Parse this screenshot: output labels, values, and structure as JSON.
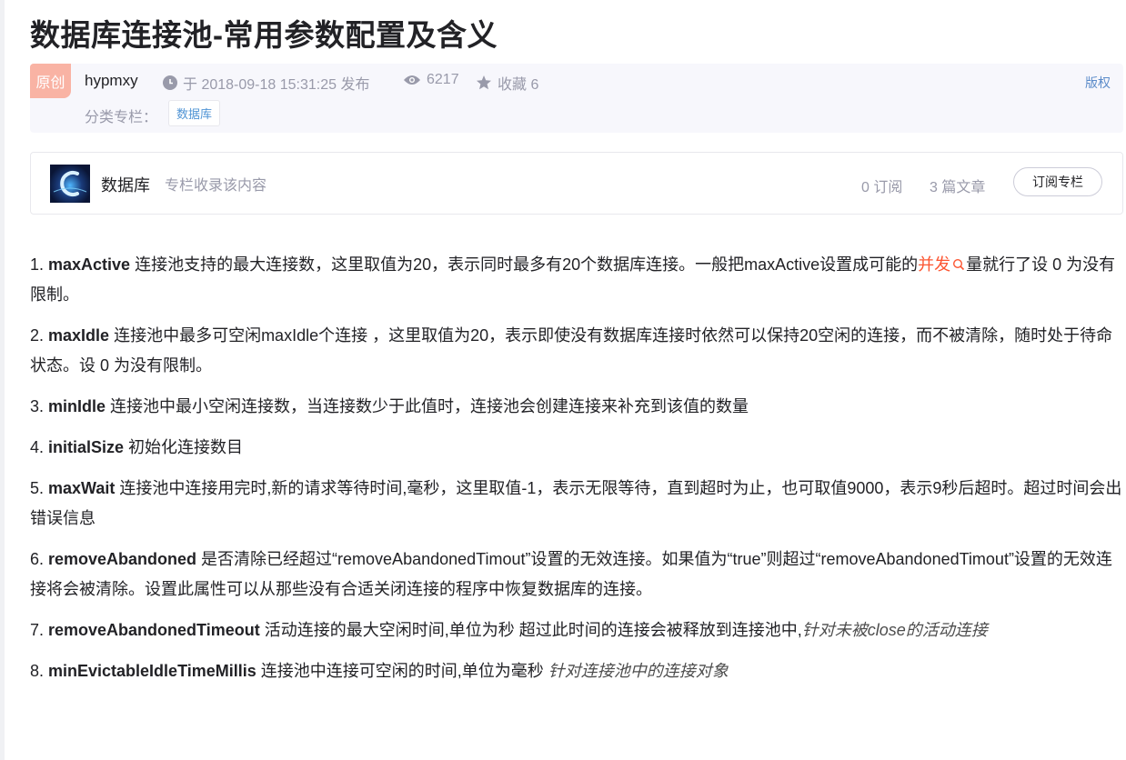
{
  "article": {
    "title": "数据库连接池-常用参数配置及含义",
    "badge": "原创",
    "author": "hypmxy",
    "published": "于 2018-09-18 15:31:25 发布",
    "views": "6217",
    "favorites": "收藏 6",
    "copyright": "版权",
    "category_label": "分类专栏：",
    "category_tag": "数据库"
  },
  "column": {
    "name": "数据库",
    "desc": "专栏收录该内容",
    "subscriptions": "0 订阅",
    "articles": "3 篇文章",
    "subscribe_label": "订阅专栏"
  },
  "params": [
    {
      "n": "1. ",
      "key": "maxActive",
      "desc": " 连接池支持的最大连接数，这里取值为20，表示同时最多有20个数据库连接。一般把maxActive设置成可能的",
      "link": "并发",
      "tail": "量就行了设 0 为没有限制。"
    },
    {
      "n": "2. ",
      "key": "maxIdle",
      "desc": " 连接池中最多可空闲maxIdle个连接 ，这里取值为20，表示即使没有数据库连接时依然可以保持20空闲的连接，而不被清除，随时处于待命状态。设 0 为没有限制。"
    },
    {
      "n": "3. ",
      "key": "minIdle",
      "desc": " 连接池中最小空闲连接数，当连接数少于此值时，连接池会创建连接来补充到该值的数量"
    },
    {
      "n": "4. ",
      "key": "initialSize",
      "desc": " 初始化连接数目"
    },
    {
      "n": "5. ",
      "key": "maxWait",
      "desc": " 连接池中连接用完时,新的请求等待时间,毫秒，这里取值-1，表示无限等待，直到超时为止，也可取值9000，表示9秒后超时。超过时间会出错误信息"
    },
    {
      "n": "6. ",
      "key": "removeAbandoned",
      "desc": " 是否清除已经超过“removeAbandonedTimout”设置的无效连接。如果值为“true”则超过“removeAbandonedTimout”设置的无效连接将会被清除。设置此属性可以从那些没有合适关闭连接的程序中恢复数据库的连接。"
    },
    {
      "n": "7. ",
      "key": "removeAbandonedTimeout",
      "desc": " 活动连接的最大空闲时间,单位为秒 超过此时间的连接会被释放到连接池中,",
      "em": "针对未被close的活动连接"
    },
    {
      "n": "8. ",
      "key": "minEvictableIdleTimeMillis",
      "desc": " 连接池中连接可空闲的时间,单位为毫秒 ",
      "em": "针对连接池中的连接对象"
    }
  ],
  "icons": {
    "clock": "clock-icon",
    "views": "eye-icon",
    "favorite": "star-icon",
    "keyword_search": "search-icon"
  },
  "colors": {
    "keyword": "#fc5531",
    "tag_text": "#5094d5",
    "badge_bg": "#f9b3a4"
  }
}
